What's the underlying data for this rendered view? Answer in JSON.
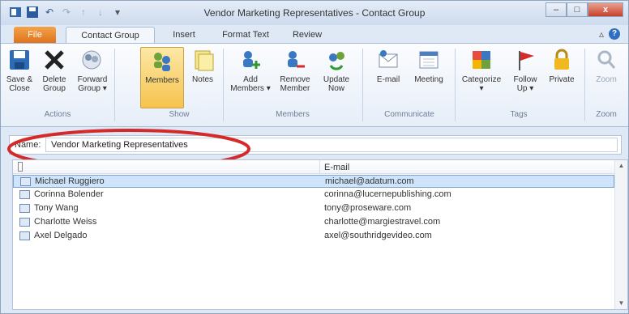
{
  "window": {
    "title": "Vendor Marketing Representatives - Contact Group",
    "buttons": {
      "minimize": "–",
      "maximize": "□",
      "close": "x"
    }
  },
  "tabs": [
    {
      "label": "File"
    },
    {
      "label": "Contact Group"
    },
    {
      "label": "Insert"
    },
    {
      "label": "Format Text"
    },
    {
      "label": "Review"
    }
  ],
  "ribbon": {
    "buttons": [
      {
        "label": "Save & Close",
        "icon": "save-icon"
      },
      {
        "label": "Delete Group",
        "icon": "delete-icon"
      },
      {
        "label": "Forward Group ▾",
        "icon": "forward-icon"
      },
      {
        "label": "Members",
        "icon": "members-icon",
        "selected": true
      },
      {
        "label": "Notes",
        "icon": "notes-icon"
      },
      {
        "label": "Add Members ▾",
        "icon": "add-members-icon"
      },
      {
        "label": "Remove Member",
        "icon": "remove-member-icon"
      },
      {
        "label": "Update Now",
        "icon": "update-now-icon"
      },
      {
        "label": "E-mail",
        "icon": "email-icon"
      },
      {
        "label": "Meeting",
        "icon": "meeting-icon"
      },
      {
        "label": "Categorize",
        "icon": "categorize-icon"
      },
      {
        "label": "Follow Up ▾",
        "icon": "flag-icon"
      },
      {
        "label": "Private",
        "icon": "lock-icon"
      },
      {
        "label": "Zoom",
        "icon": "zoom-icon"
      }
    ],
    "groups": [
      "Members",
      "Communicate",
      "Tags",
      "Zoom"
    ]
  },
  "name_field": {
    "label": "Name:",
    "value": "Vendor Marketing Representatives"
  },
  "list": {
    "columns": [
      "",
      "E-mail"
    ],
    "rows": [
      {
        "name": "Michael Ruggiero",
        "email": "michael@adatum.com",
        "selected": true
      },
      {
        "name": "Corinna Bolender",
        "email": "corinna@lucernepublishing.com"
      },
      {
        "name": "Tony Wang",
        "email": "tony@proseware.com"
      },
      {
        "name": "Charlotte Weiss",
        "email": "charlotte@margiestravel.com"
      },
      {
        "name": "Axel Delgado",
        "email": "axel@southridgevideo.com"
      }
    ]
  },
  "colors": {
    "accent": "#f6c34d",
    "annotation": "#d42a2a",
    "selection": "#cfe3fb"
  }
}
